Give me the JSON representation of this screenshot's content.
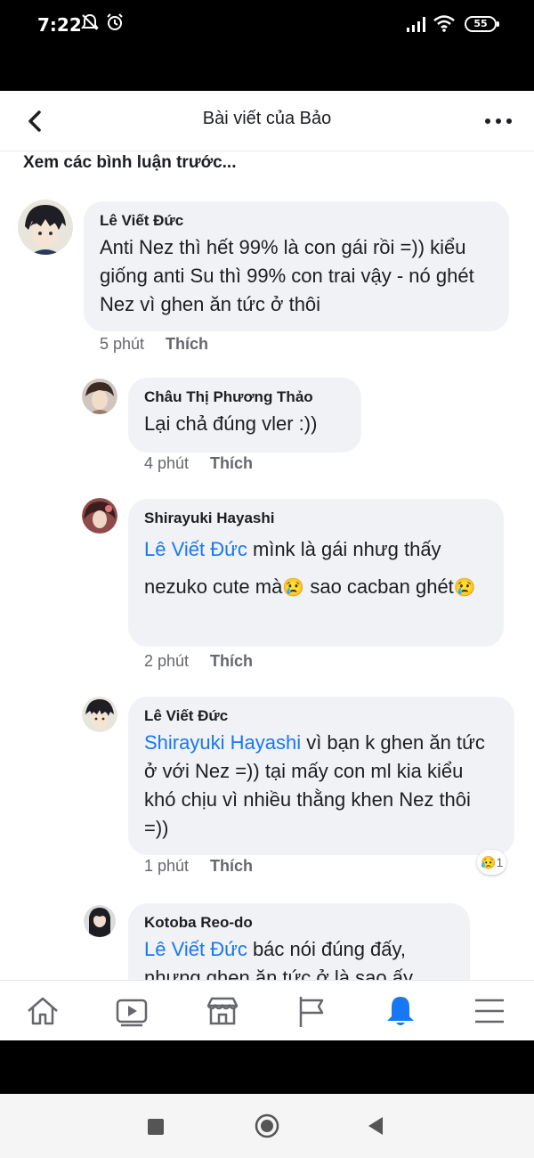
{
  "status_bar": {
    "time": "7:22",
    "battery": "55",
    "icons": [
      "mute-icon",
      "alarm-icon",
      "signal-icon",
      "wifi-icon",
      "battery-icon"
    ]
  },
  "header": {
    "title": "Bài viết của Bảo",
    "back_icon": "back-arrow-icon",
    "more_icon": "more-icon"
  },
  "see_previous": "Xem các bình luận trước...",
  "comments": [
    {
      "author": "Lê Viết Đức",
      "text": "Anti Nez thì hết 99% là con gái rồi =)) kiểu giống anti Su thì 99% con trai vậy - nó ghét Nez vì ghen ăn tức ở thôi",
      "time": "5 phút",
      "like": "Thích"
    },
    {
      "author": "Châu Thị Phương Thảo",
      "text": "Lại chả đúng vler :))",
      "time": "4 phút",
      "like": "Thích"
    },
    {
      "author": "Shirayuki Hayashi",
      "mention": "Lê Viết Đức",
      "text_1": " mìnk là gái nhưg thấy nezuko cute mà",
      "emoji_1": "😢",
      "text_2": " sao cacban ghét",
      "emoji_2": "😢",
      "time": "2 phút",
      "like": "Thích"
    },
    {
      "author": "Lê Viết Đức",
      "mention": "Shirayuki Hayashi",
      "text": " vì bạn k ghen ăn tức ở với Nez =)) tại mấy con ml kia kiểu khó chịu vì nhiều thằng khen Nez thôi =))",
      "time": "1 phút",
      "like": "Thích",
      "reaction_emoji": "😥",
      "reaction_count": "1"
    },
    {
      "author": "Kotoba Reo-do",
      "mention": "Lê Viết Đức",
      "text": " bác nói đúng đấy, nhưng ghen ăn tức ở là sao ấy"
    }
  ],
  "tabbar": [
    "home-icon",
    "watch-icon",
    "marketplace-icon",
    "pages-icon",
    "notifications-icon",
    "menu-icon"
  ],
  "android_nav": [
    "recents-button",
    "home-button",
    "back-button"
  ],
  "colors": {
    "accent": "#1877f2",
    "bubble": "#f0f2f5",
    "text": "#1c1e21",
    "meta": "#65676b"
  }
}
